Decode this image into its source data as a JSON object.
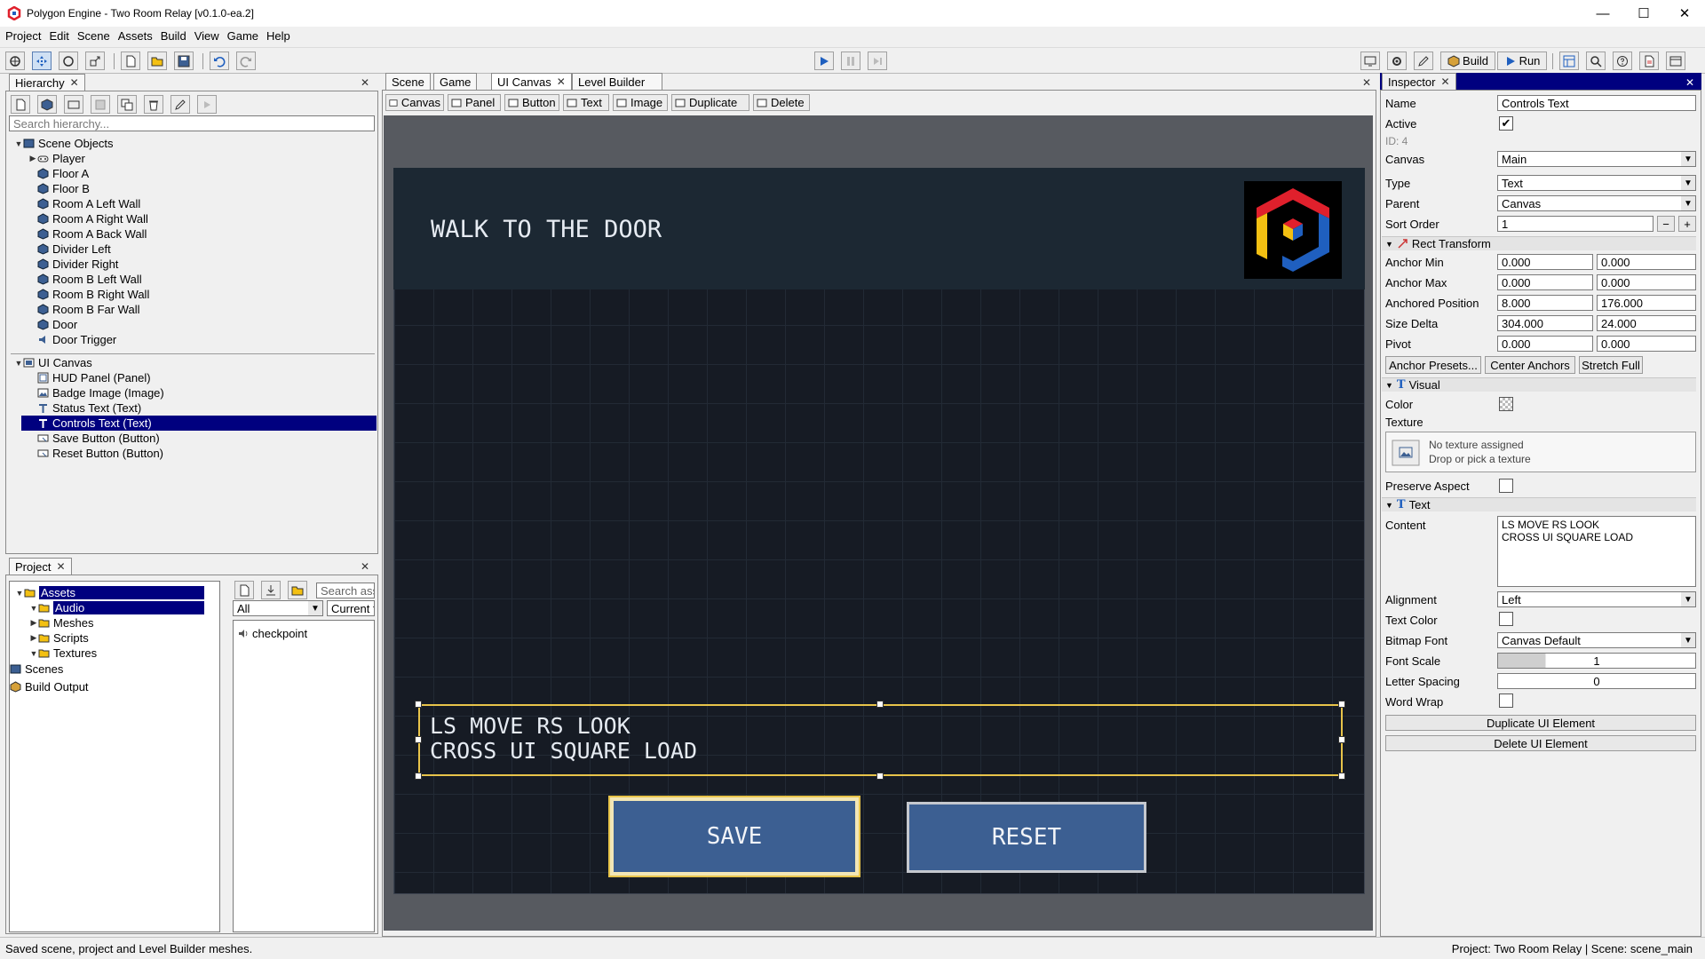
{
  "window": {
    "title": "Polygon Engine - Two Room Relay [v0.1.0-ea.2]",
    "min": "—",
    "max": "☐",
    "close": "✕"
  },
  "menu": [
    "Project",
    "Edit",
    "Scene",
    "Assets",
    "Build",
    "View",
    "Game",
    "Help"
  ],
  "toolbar": {
    "build_label": "Build",
    "run_label": "Run"
  },
  "hierarchy": {
    "tab": "Hierarchy",
    "search_placeholder": "Search hierarchy...",
    "scene_root": "Scene Objects",
    "scene_items": [
      "Player",
      "Floor A",
      "Floor B",
      "Room A Left Wall",
      "Room A Right Wall",
      "Room A Back Wall",
      "Divider Left",
      "Divider Right",
      "Room B Left Wall",
      "Room B Right Wall",
      "Room B Far Wall",
      "Door",
      "Door Trigger"
    ],
    "ui_root": "UI Canvas",
    "ui_items": [
      "HUD Panel (Panel)",
      "Badge Image (Image)",
      "Status Text (Text)",
      "Controls Text (Text)",
      "Save Button (Button)",
      "Reset Button (Button)"
    ],
    "selected": "Controls Text (Text)"
  },
  "project": {
    "tab": "Project",
    "tree": [
      "Assets",
      "Audio",
      "Meshes",
      "Scripts",
      "Textures",
      "Scenes",
      "Build Output"
    ],
    "filter": "All",
    "search_placeholder": "Search ass",
    "scope": "Current f",
    "files": [
      "checkpoint"
    ]
  },
  "center": {
    "tabs": [
      "Scene",
      "Game",
      "UI Canvas",
      "Level Builder"
    ],
    "active_tab": "UI Canvas",
    "tools": [
      "Canvas",
      "Panel",
      "Button",
      "Text",
      "Image",
      "Duplicate",
      "Delete"
    ]
  },
  "canvas_ui": {
    "status_text": "WALK TO THE DOOR",
    "controls_line1": "LS MOVE  RS LOOK",
    "controls_line2": "CROSS UI  SQUARE LOAD",
    "save_label": "SAVE",
    "reset_label": "RESET",
    "colors": {
      "panel": "#1c2833",
      "button": "#3c5f92",
      "selection": "#e8c44a",
      "logo_red": "#e0202c",
      "logo_yellow": "#f3c012",
      "logo_blue": "#1f5fbf"
    }
  },
  "inspector": {
    "tab": "Inspector",
    "name_label": "Name",
    "name_value": "Controls Text",
    "active_label": "Active",
    "active_check": "✔",
    "id_text": "ID: 4",
    "canvas_label": "Canvas",
    "canvas_value": "Main",
    "type_label": "Type",
    "type_value": "Text",
    "parent_label": "Parent",
    "parent_value": "Canvas",
    "sort_label": "Sort Order",
    "sort_value": "1",
    "sort_minus": "−",
    "sort_plus": "+",
    "rect_section": "Rect Transform",
    "anchor_min_label": "Anchor Min",
    "anchor_min": [
      "0.000",
      "0.000"
    ],
    "anchor_max_label": "Anchor Max",
    "anchor_max": [
      "0.000",
      "0.000"
    ],
    "anchored_pos_label": "Anchored Position",
    "anchored_pos": [
      "8.000",
      "176.000"
    ],
    "size_delta_label": "Size Delta",
    "size_delta": [
      "304.000",
      "24.000"
    ],
    "pivot_label": "Pivot",
    "pivot": [
      "0.000",
      "0.000"
    ],
    "anchor_presets": "Anchor Presets...",
    "center_anchors": "Center Anchors",
    "stretch_full": "Stretch Full",
    "visual_section": "Visual",
    "color_label": "Color",
    "texture_label": "Texture",
    "texture_none": "No texture assigned",
    "texture_hint": "Drop or pick a texture",
    "preserve_label": "Preserve Aspect",
    "text_section": "Text",
    "content_label": "Content",
    "content_line1": "LS MOVE  RS LOOK",
    "content_line2": "CROSS UI  SQUARE LOAD",
    "alignment_label": "Alignment",
    "alignment_value": "Left",
    "text_color_label": "Text Color",
    "bitmap_font_label": "Bitmap Font",
    "bitmap_font_value": "Canvas Default",
    "font_scale_label": "Font Scale",
    "font_scale_value": "1",
    "letter_spacing_label": "Letter Spacing",
    "letter_spacing_value": "0",
    "word_wrap_label": "Word Wrap",
    "duplicate_btn": "Duplicate UI Element",
    "delete_btn": "Delete UI Element"
  },
  "status": {
    "left": "Saved scene, project and Level Builder meshes.",
    "right": "Project: Two Room Relay  |  Scene: scene_main"
  }
}
